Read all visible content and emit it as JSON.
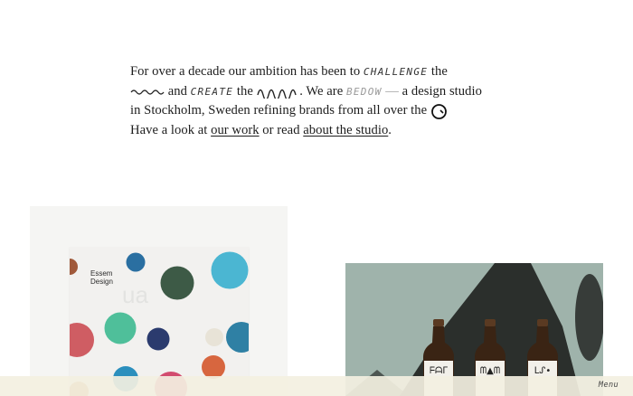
{
  "intro": {
    "p1": "For over a decade our ambition has been to ",
    "challenge": "CHALLENGE",
    "p2": " the",
    "p3": " and ",
    "create": "CREATE",
    "p4": " the ",
    "p5": " . We are ",
    "brand": "BEDOW",
    "dash": " — ",
    "p6": "a design studio",
    "p7": "in Stockholm, Sweden refining brands from all over the ",
    "p8": "Have a look at ",
    "link_work": "our work",
    "p9": " or read ",
    "link_studio": "about the studio",
    "p10": "."
  },
  "projects": [
    {
      "title": "Essem",
      "subtitle": "Design"
    }
  ],
  "bottles": [
    {
      "label": "ᖴᗩᒥ"
    },
    {
      "label": "ᗰ▲ᗰ"
    },
    {
      "label": "ᒪᔑ•"
    }
  ],
  "footer": {
    "menu_label": "Menu"
  },
  "colors": {
    "background": "#ffffff",
    "footer_bar": "#f3f0e1",
    "bottle_bg": "#9fb3ab"
  }
}
